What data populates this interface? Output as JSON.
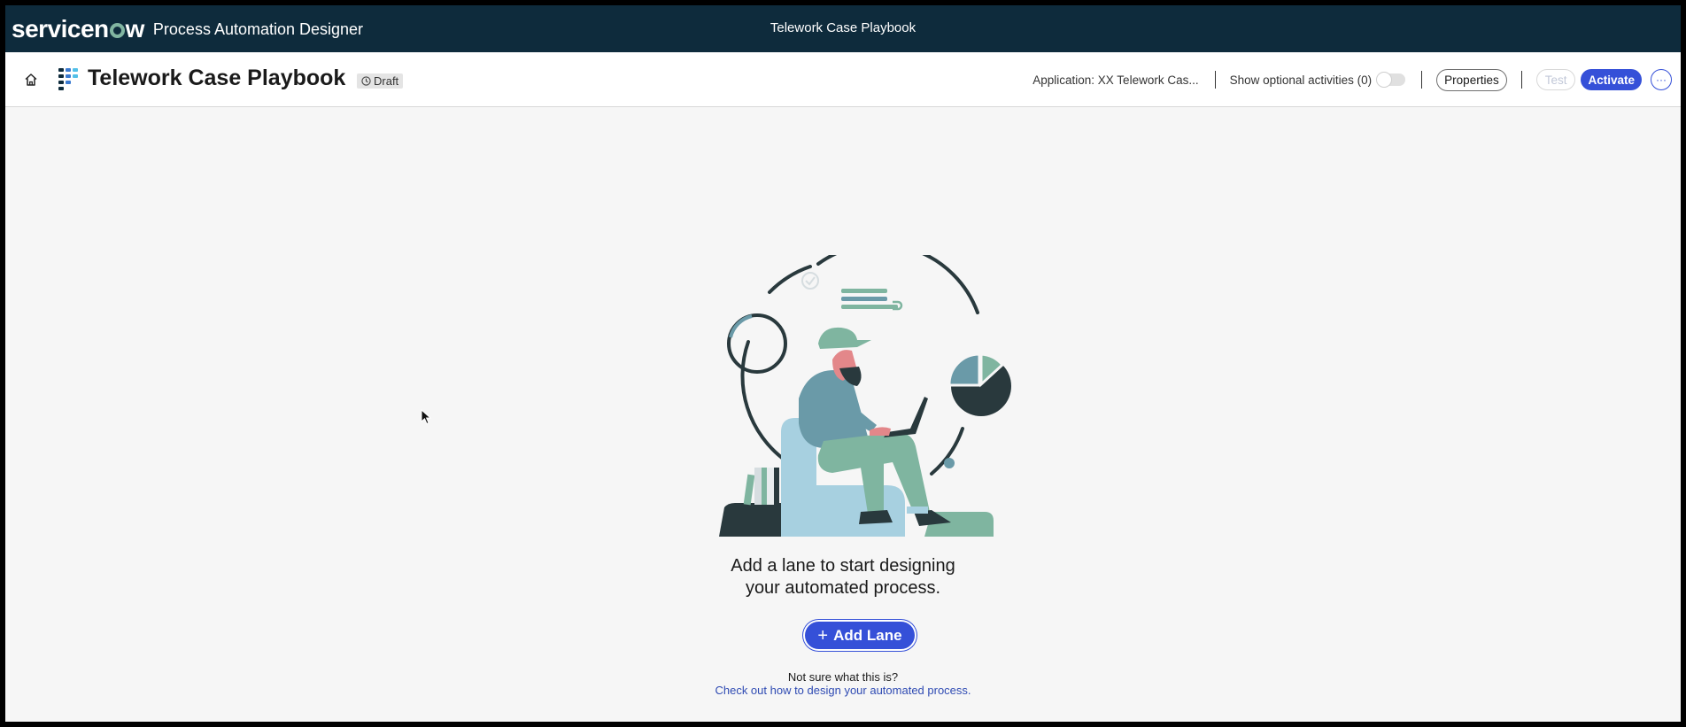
{
  "topbar": {
    "brand_prefix": "servicen",
    "brand_suffix": "w",
    "product_name": "Process Automation Designer",
    "center_title": "Telework Case Playbook",
    "accent_color": "#81b5a1",
    "background_color": "#0e2b3c"
  },
  "header": {
    "home_icon": "home-icon",
    "playbook_icon": "playbook-icon",
    "title": "Telework Case Playbook",
    "status": "Draft",
    "status_icon": "clock-icon",
    "application_label": "Application: XX Telework Cas...",
    "optional_activities_label": "Show optional activities (0)",
    "optional_activities_enabled": false,
    "properties_label": "Properties",
    "test_label": "Test",
    "activate_label": "Activate",
    "more_label": "···",
    "primary_color": "#3550d8"
  },
  "empty_state": {
    "message_line1": "Add a lane to start designing",
    "message_line2": "your automated process.",
    "add_lane_label": "Add Lane",
    "help_question": "Not sure what this is?",
    "help_link": "Check out how to design your automated process."
  }
}
